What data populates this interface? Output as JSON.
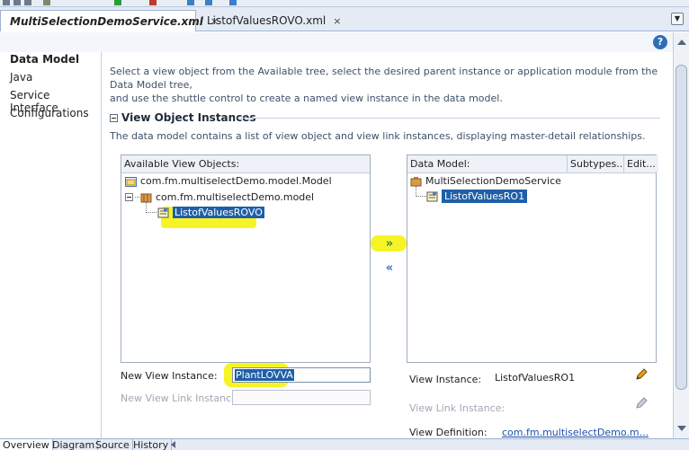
{
  "tabs": [
    {
      "label": "MultiSelectionDemoService.xml",
      "close": "×",
      "active": true
    },
    {
      "label": "ListofValuesROVO.xml",
      "close": "×",
      "active": false
    }
  ],
  "help_label": "?",
  "nav": {
    "items": [
      {
        "label": "Data Model",
        "selected": true
      },
      {
        "label": "Java",
        "selected": false
      },
      {
        "label": "Service Interface",
        "selected": false
      },
      {
        "label": "Configurations",
        "selected": false
      }
    ]
  },
  "content": {
    "description_line1": "Select a view object from the Available tree, select the desired parent instance or application module from the Data Model tree,",
    "description_line2": "and use the shuttle control to create a named view instance in the data model.",
    "section_title": "View Object Instances",
    "section_description": "The data model contains a list of view object and view link instances, displaying master-detail relationships."
  },
  "available": {
    "header": "Available View Objects:",
    "items": [
      {
        "label": "com.fm.multiselectDemo.model.Model",
        "icon": "folder-icon"
      },
      {
        "label": "com.fm.multiselectDemo.model",
        "icon": "package-icon"
      },
      {
        "label": "ListofValuesROVO",
        "icon": "view-object-icon"
      }
    ]
  },
  "datamodel": {
    "header": "Data Model:",
    "subtypes_label": "Subtypes...",
    "edit_label": "Edit...",
    "items": [
      {
        "label": "MultiSelectionDemoService",
        "icon": "app-module-icon"
      },
      {
        "label": "ListofValuesRO1",
        "icon": "view-instance-icon"
      }
    ]
  },
  "shuttle": {
    "add": "»",
    "remove": "«"
  },
  "form": {
    "new_view_instance_label": "New View Instance:",
    "new_view_instance_value": "PlantLOVVA",
    "new_view_link_instance_label": "New View Link Instance:",
    "new_view_link_instance_value": "",
    "view_instance_label": "View Instance:",
    "view_instance_value": "ListofValuesRO1",
    "view_link_instance_label": "View Link Instance:",
    "view_definition_label": "View Definition:",
    "view_definition_value": "com.fm.multiselectDemo.m..."
  },
  "bottom_tabs": [
    "Overview",
    "Diagram",
    "Source",
    "History"
  ],
  "colors": {
    "highlight": "#f5f200",
    "selection": "#1f5fa8",
    "accent": "#2f6fb7"
  }
}
